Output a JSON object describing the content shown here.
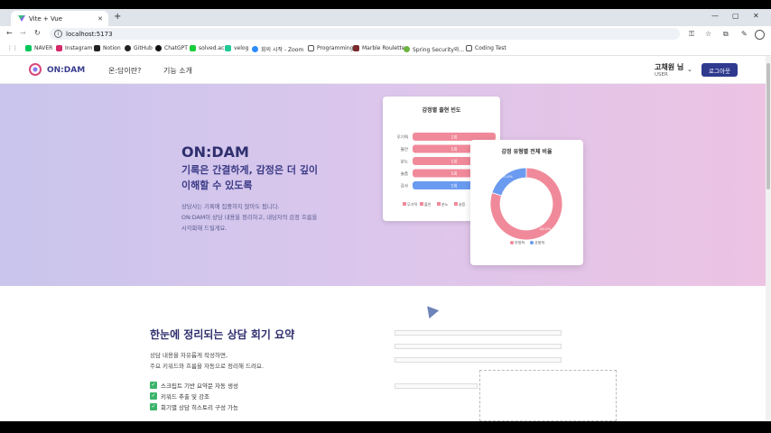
{
  "browser": {
    "tab_title": "Vite + Vue",
    "url": "localhost:5173",
    "bookmarks": [
      "NAVER",
      "Instagram",
      "Notion",
      "GitHub",
      "ChatGPT",
      "solved.ac",
      "velog",
      "회의 시작 - Zoom",
      "Programming",
      "Marble Roulette",
      "Spring Security와...",
      "Coding Test"
    ]
  },
  "header": {
    "brand": "ON:DAM",
    "nav": [
      "온:담이란?",
      "기능 소개"
    ],
    "user_name": "고채원 님",
    "user_role": "USER",
    "logout": "로그아웃"
  },
  "hero": {
    "title": "ON:DAM",
    "sub1": "기록은 간결하게, 감정은 더 깊이",
    "sub2": "이해할 수 있도록",
    "desc": [
      "상담사는 기록에 집중하지 않아도 됩니다.",
      "ON:DAM이 상담 내용을 정리하고, 내담자의 감정 흐름을",
      "시각화해 드릴게요."
    ]
  },
  "chart_data": [
    {
      "type": "bar",
      "title": "감정별 출현 빈도",
      "categories": [
        "무기력",
        "불안",
        "분노",
        "슬픔",
        "감사"
      ],
      "values": [
        1,
        1,
        1,
        1,
        1
      ],
      "data_labels": [
        "1회",
        "1회",
        "1회",
        "1회",
        "1회"
      ],
      "colors": [
        "#f08a9a",
        "#f08a9a",
        "#f08a9a",
        "#f08a9a",
        "#6b9bf0"
      ],
      "legend": [
        "무기력",
        "불안",
        "분노",
        "슬픔",
        "감사"
      ]
    },
    {
      "type": "pie",
      "title": "감정 유형별 전체 비율",
      "categories": [
        "부정적",
        "긍정적"
      ],
      "values": [
        80.0,
        20.0
      ],
      "data_labels": [
        "80.0%",
        "20.0%"
      ],
      "colors": [
        "#f08a9a",
        "#6b9bf0"
      ],
      "legend": [
        "부정적",
        "긍정적"
      ]
    }
  ],
  "section2": {
    "title": "한눈에 정리되는 상담 회기 요약",
    "desc": [
      "상담 내용을 자유롭게 작성하면,",
      "주요 키워드와 흐름을 자동으로 정리해 드려요."
    ],
    "features": [
      "스크립트 기반 요약문 자동 생성",
      "키워드 추출 및 강조",
      "회기별 상담 히스토리 구성 가능"
    ]
  }
}
